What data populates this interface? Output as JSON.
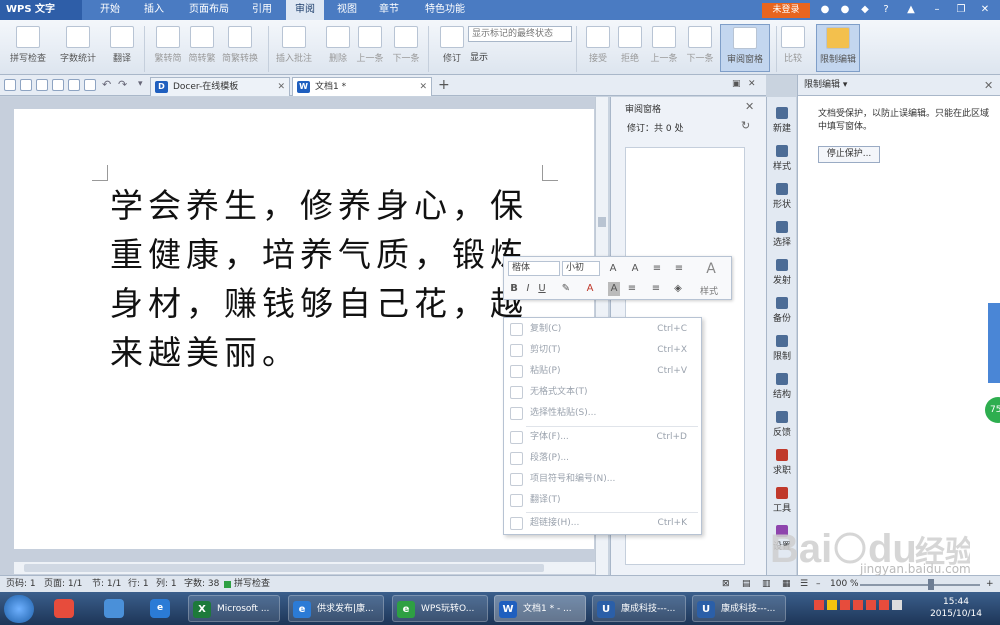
{
  "menubar": {
    "app_name": "WPS 文字",
    "tabs": [
      "开始",
      "插入",
      "页面布局",
      "引用",
      "审阅",
      "视图",
      "章节",
      "特色功能"
    ],
    "active_tab": "审阅",
    "login": "未登录",
    "help": "?",
    "colors": {
      "bar": "#4a7bc2",
      "login": "#e8651f"
    }
  },
  "ribbon": {
    "spellcheck": "拼写检查",
    "wordcount": "字数统计",
    "translate": "翻译",
    "to_simplified": "繁转简",
    "to_traditional": "简转繁",
    "convert": "简繁转换",
    "insert_comment": "插入批注",
    "delete": "删除",
    "prev_comment": "上一条",
    "next_comment": "下一条",
    "track": "修订",
    "markup_select": "显示标记的最终状态",
    "show": "显示",
    "accept": "接受",
    "reject": "拒绝",
    "prev_change": "上一条",
    "next_change": "下一条",
    "review_pane": "审阅窗格",
    "compare": "比较",
    "restrict": "限制编辑"
  },
  "doc_tabs": [
    {
      "label": "Docer-在线模板",
      "badge": "D",
      "color": "#1f5fbf"
    },
    {
      "label": "文档1 *",
      "badge": "W",
      "color": "#1f5fbf"
    }
  ],
  "document": {
    "lines": [
      "学会养生，修养身心，保",
      "重健康，培养气质，锻炼",
      "身材，赚钱够自己花，越",
      "来越美丽。"
    ]
  },
  "review_pane": {
    "title": "审阅窗格",
    "count": "修订：共 0 处"
  },
  "mini_toolbar": {
    "font": "楷体",
    "size": "小初",
    "styles": "样式"
  },
  "context_menu": {
    "items": [
      {
        "label": "复制(C)",
        "shortcut": "Ctrl+C",
        "icon": "copy-icon"
      },
      {
        "label": "剪切(T)",
        "shortcut": "Ctrl+X",
        "icon": "scissors-icon"
      },
      {
        "label": "粘贴(P)",
        "shortcut": "Ctrl+V",
        "icon": "paste-icon"
      },
      {
        "label": "无格式文本(T)",
        "shortcut": "",
        "icon": "plain-text-icon"
      },
      {
        "label": "选择性粘贴(S)...",
        "shortcut": "",
        "icon": "paste-special-icon"
      },
      {
        "label": "字体(F)...",
        "shortcut": "Ctrl+D",
        "icon": "font-icon"
      },
      {
        "label": "段落(P)...",
        "shortcut": "",
        "icon": "paragraph-icon"
      },
      {
        "label": "项目符号和编号(N)...",
        "shortcut": "",
        "icon": "bullets-icon"
      },
      {
        "label": "翻译(T)",
        "shortcut": "",
        "icon": "translate-icon"
      },
      {
        "label": "超链接(H)...",
        "shortcut": "Ctrl+K",
        "icon": "hyperlink-icon"
      }
    ]
  },
  "sidebar": {
    "items": [
      "新建",
      "样式",
      "形状",
      "选择",
      "发射",
      "备份",
      "限制",
      "结构",
      "反馈",
      "求职",
      "工具",
      "设置"
    ]
  },
  "restrict_pane": {
    "title": "限制编辑",
    "message": "文档受保护，以防止误编辑。只能在此区域中填写窗体。",
    "button": "停止保护..."
  },
  "statusbar": {
    "page": "页码: 1",
    "pages": "页面: 1/1",
    "section": "节: 1/1",
    "row": "行: 1",
    "col": "列: 1",
    "words": "字数: 38",
    "spell": "拼写检查",
    "zoom": "100 %"
  },
  "taskbar": {
    "apps": [
      {
        "label": "Microsoft ...",
        "icon": "X",
        "color": "#1d7a3a"
      },
      {
        "label": "供求发布|康...",
        "icon": "e",
        "color": "#2b7bd6"
      },
      {
        "label": "WPS玩转O...",
        "icon": "e",
        "color": "#2ea043"
      },
      {
        "label": "文档1 * - ...",
        "icon": "W",
        "color": "#1f5fbf"
      },
      {
        "label": "康成科技---...",
        "icon": "U",
        "color": "#2b5fa8"
      },
      {
        "label": "康成科技---...",
        "icon": "U",
        "color": "#2b5fa8"
      }
    ],
    "time": "15:44",
    "date": "2015/10/14"
  },
  "watermark": {
    "url": "jingyan.baidu.com"
  }
}
